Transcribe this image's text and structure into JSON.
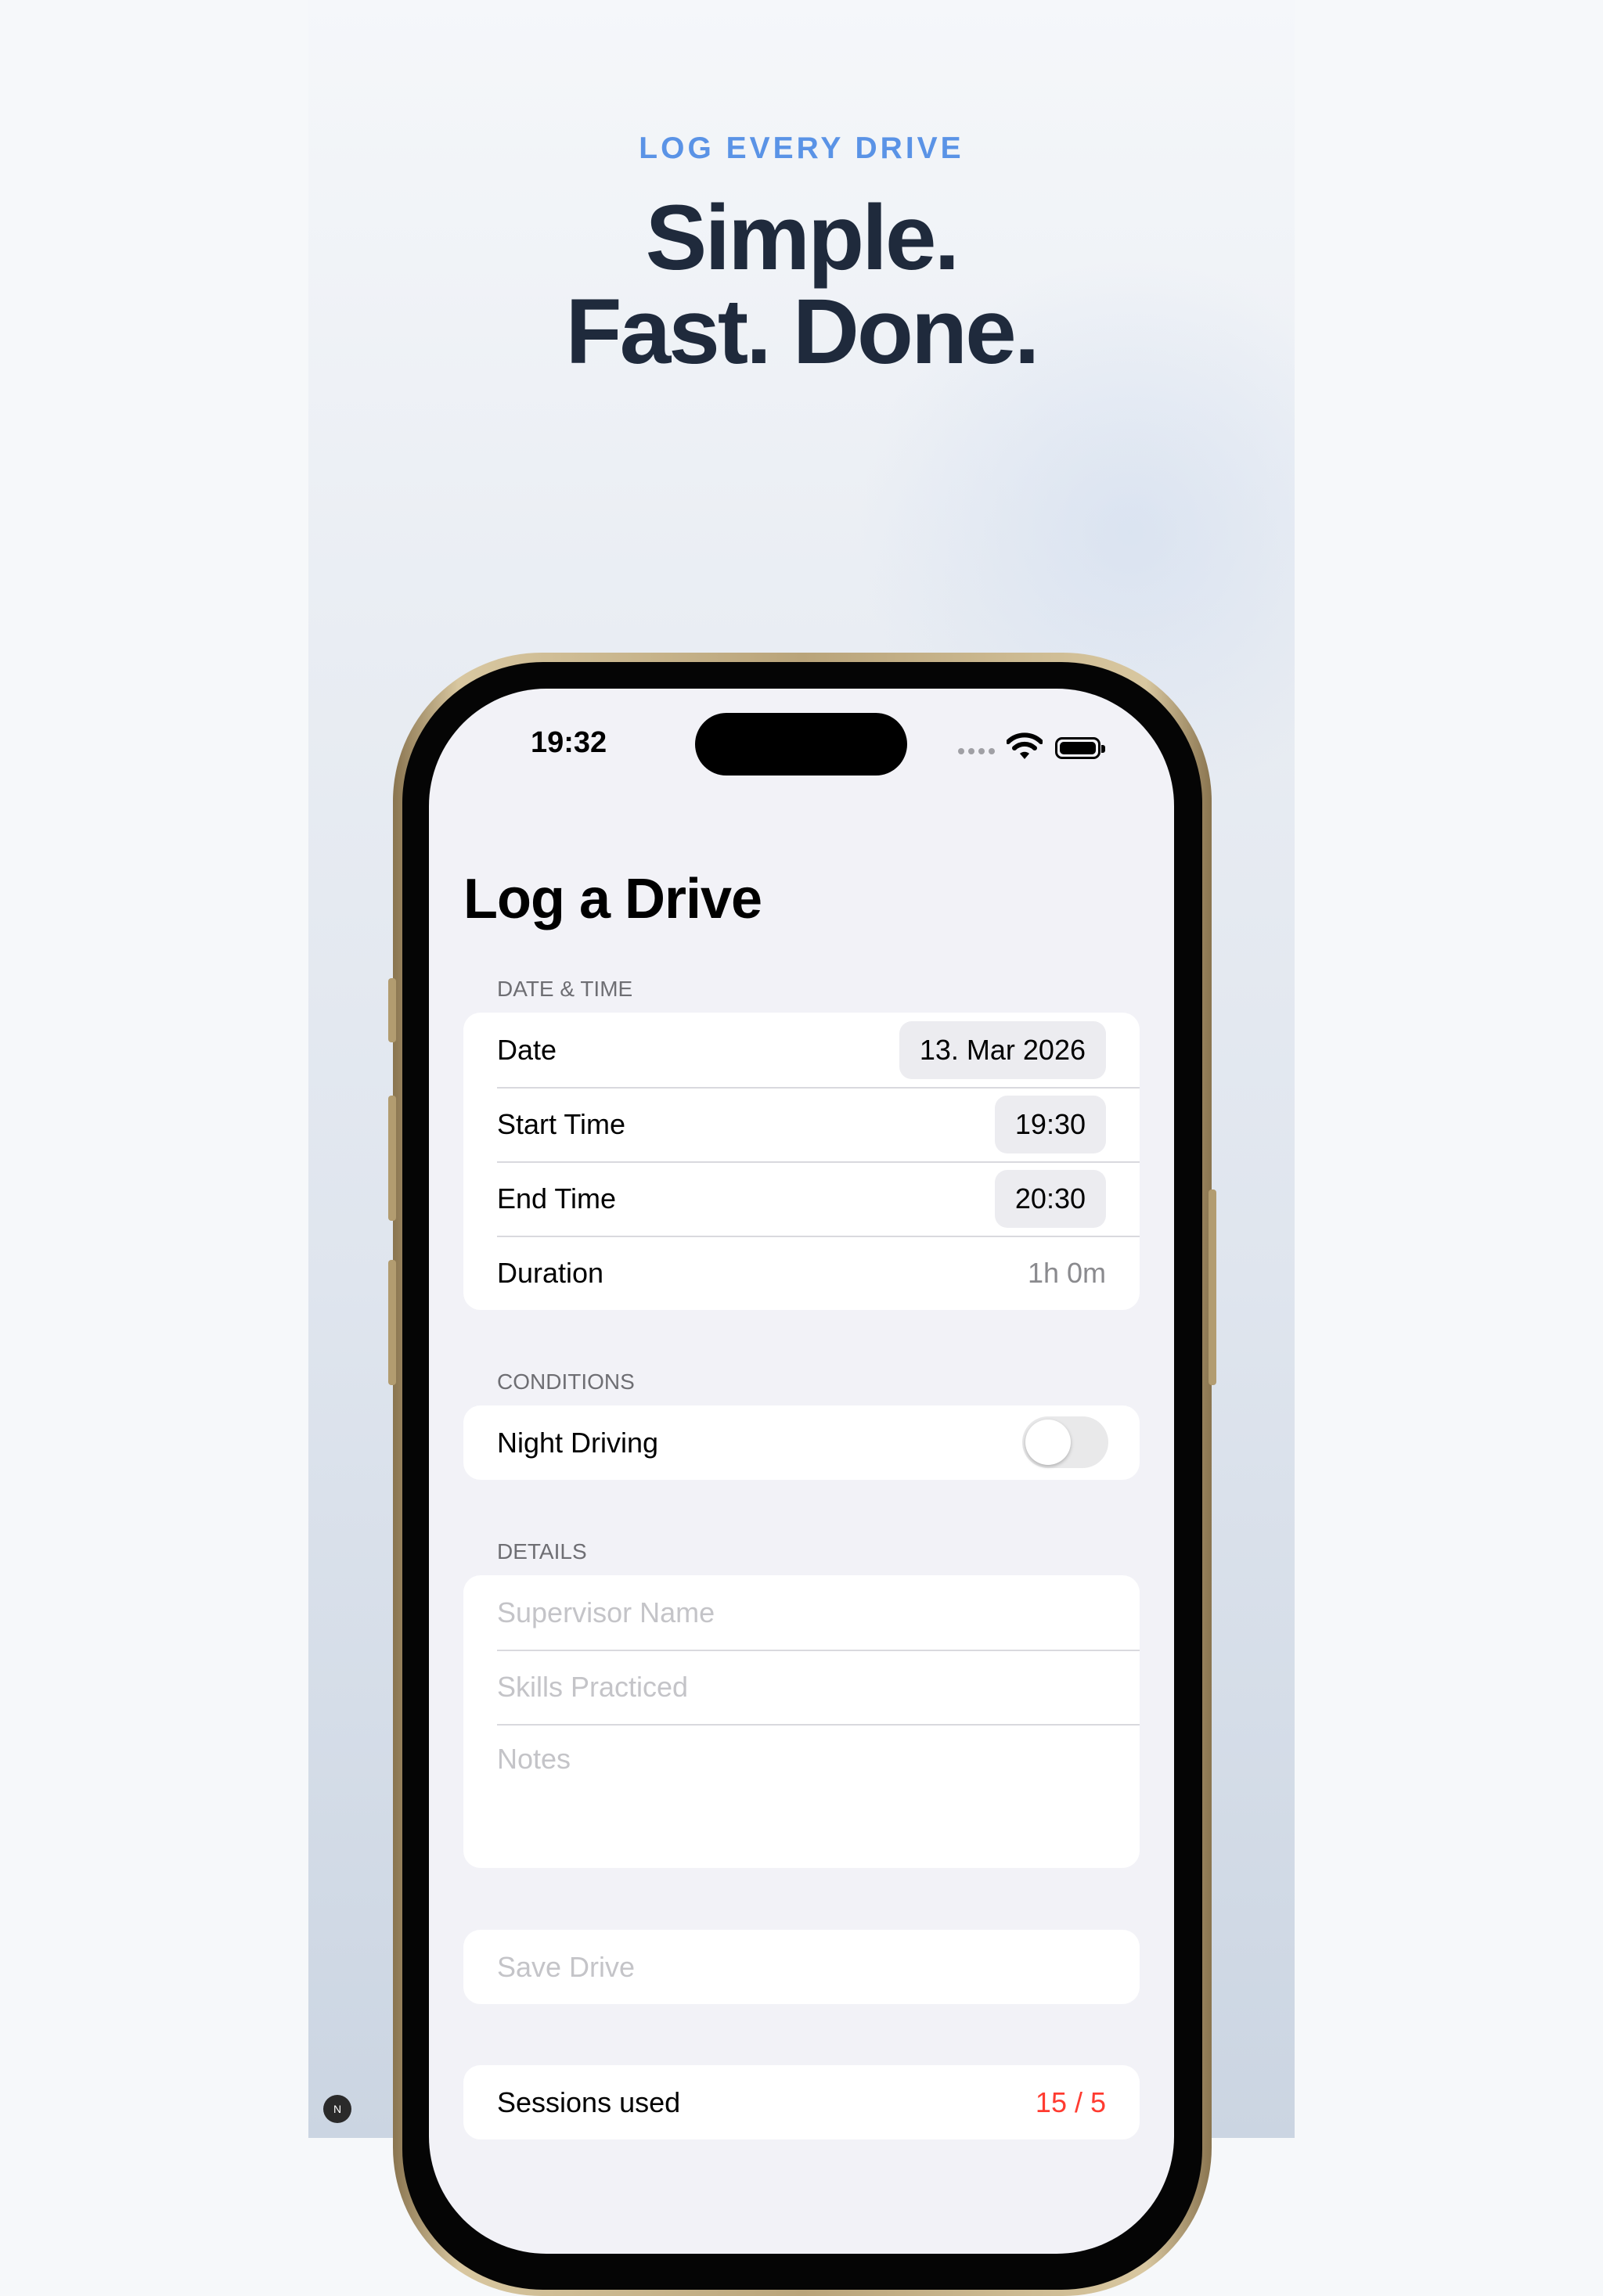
{
  "promo": {
    "eyebrow": "LOG EVERY DRIVE",
    "headline_line1": "Simple.",
    "headline_line2": "Fast. Done.",
    "accent_color": "#5a93e6"
  },
  "status_bar": {
    "time": "19:32",
    "icons": [
      "cellular-dots-icon",
      "wifi-icon",
      "battery-icon"
    ]
  },
  "screen": {
    "title": "Log a Drive",
    "sections": {
      "date_time": {
        "header": "DATE & TIME",
        "date_label": "Date",
        "date_value": "13. Mar 2026",
        "start_label": "Start Time",
        "start_value": "19:30",
        "end_label": "End Time",
        "end_value": "20:30",
        "duration_label": "Duration",
        "duration_value": "1h 0m"
      },
      "conditions": {
        "header": "CONDITIONS",
        "night_label": "Night Driving",
        "night_on": false
      },
      "details": {
        "header": "DETAILS",
        "supervisor_placeholder": "Supervisor Name",
        "skills_placeholder": "Skills Practiced",
        "notes_placeholder": "Notes"
      },
      "save": {
        "label": "Save Drive"
      },
      "usage": {
        "label": "Sessions used",
        "value": "15 / 5",
        "value_color": "#ff3b30"
      }
    }
  },
  "corner_badge": "N"
}
